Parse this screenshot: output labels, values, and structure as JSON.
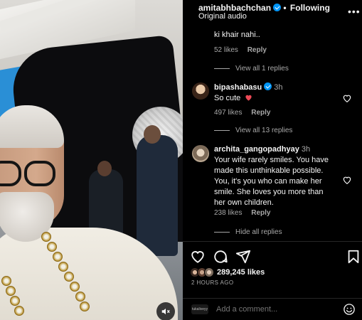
{
  "post": {
    "username": "amitabhbachchan",
    "separator": "•",
    "follow_state": "Following",
    "audio": "Original audio",
    "more": "•••"
  },
  "comments": [
    {
      "text_fragment": "ki khair nahi..",
      "likes": "52 likes",
      "reply": "Reply",
      "view_replies": "View all 1 replies"
    },
    {
      "username": "bipashabasu",
      "time": "3h",
      "text": "So cute",
      "likes": "497 likes",
      "reply": "Reply",
      "view_replies": "View all 13 replies"
    },
    {
      "username": "archita_gangopadhyay",
      "time": "3h",
      "text": "Your wife rarely smiles. You have made this unthinkable possible. You, it's you who can make her smile. She loves you more than her own children.",
      "likes": "238 likes",
      "reply": "Reply",
      "view_replies": "Hide all replies"
    }
  ],
  "stats": {
    "likes": "289,245 likes",
    "date": "2 HOURS AGO"
  },
  "composer": {
    "placeholder": "Add a comment...",
    "avatar_text": "tukaliveyy"
  },
  "colors": {
    "verified": "#0095f6",
    "heart_emoji": "#ed4956",
    "muted_text": "#a8a8a8"
  },
  "icons": [
    "verified-badge-icon",
    "more-icon",
    "heart-icon",
    "comment-icon",
    "share-icon",
    "bookmark-icon",
    "emoji-icon",
    "speaker-muted-icon",
    "red-heart-emoji-icon"
  ]
}
